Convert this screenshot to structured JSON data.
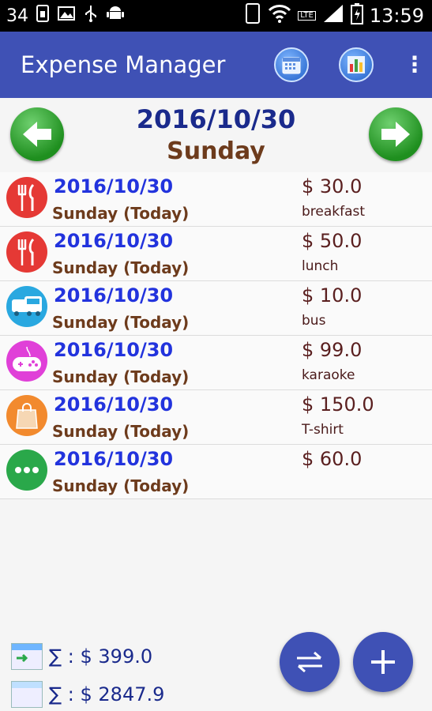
{
  "status_bar": {
    "notif_count": "34",
    "network": "LTE",
    "time": "13:59"
  },
  "app_bar": {
    "title": "Expense Manager",
    "actions": [
      "calendar-icon",
      "chart-icon",
      "overflow-menu-icon"
    ]
  },
  "date_header": {
    "date": "2016/10/30",
    "day": "Sunday"
  },
  "expenses": [
    {
      "date": "2016/10/30",
      "day": "Sunday (Today)",
      "amount": "$ 30.0",
      "note": "breakfast",
      "category": "food",
      "color": "#e53935"
    },
    {
      "date": "2016/10/30",
      "day": "Sunday (Today)",
      "amount": "$ 50.0",
      "note": "lunch",
      "category": "food",
      "color": "#e53935"
    },
    {
      "date": "2016/10/30",
      "day": "Sunday (Today)",
      "amount": "$ 10.0",
      "note": "bus",
      "category": "transport",
      "color": "#29a8e0"
    },
    {
      "date": "2016/10/30",
      "day": "Sunday (Today)",
      "amount": "$ 99.0",
      "note": "karaoke",
      "category": "entertainment",
      "color": "#e040d8"
    },
    {
      "date": "2016/10/30",
      "day": "Sunday (Today)",
      "amount": "$ 150.0",
      "note": "T-shirt",
      "category": "shopping",
      "color": "#f28a2e"
    },
    {
      "date": "2016/10/30",
      "day": "Sunday (Today)",
      "amount": "$ 60.0",
      "note": "",
      "category": "other",
      "color": "#2aa84a"
    }
  ],
  "totals": {
    "day_total": "∑ : $ 399.0",
    "overall_total": "∑ : $ 2847.9"
  },
  "colors": {
    "primary": "#3f51b5",
    "date_blue": "#2233dd",
    "day_brown": "#6d3b1c"
  }
}
